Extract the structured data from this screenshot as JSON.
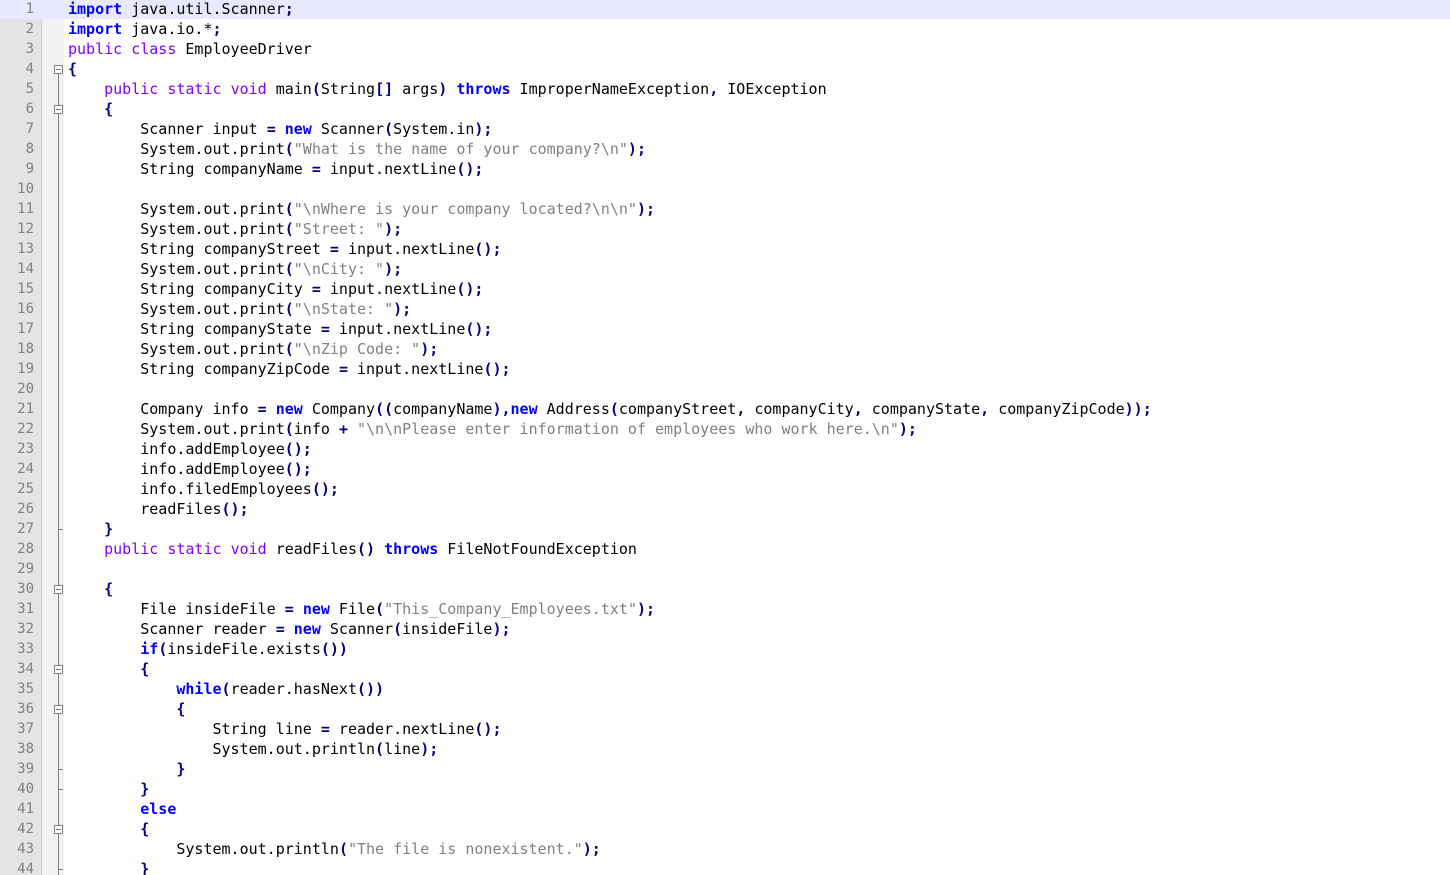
{
  "editor": {
    "current_line": 1,
    "lines": [
      {
        "n": "1",
        "code": "<span class='kw'>import</span> java.util.Scanner<span class='op'>;</span>"
      },
      {
        "n": "2",
        "code": "<span class='kw'>import</span> java.io.*<span class='op'>;</span>"
      },
      {
        "n": "3",
        "code": "<span class='kw2'>public</span> <span class='kw2'>class</span> EmployeeDriver"
      },
      {
        "n": "4",
        "code": "<span class='op'>{</span>"
      },
      {
        "n": "5",
        "code": "    <span class='kw2'>public</span> <span class='kw2'>static</span> <span class='kw2'>void</span> main<span class='op'>(</span>String<span class='op'>[]</span> args<span class='op'>)</span> <span class='kw'>throws</span> ImproperNameException<span class='op'>,</span> IOException"
      },
      {
        "n": "6",
        "code": "    <span class='op'>{</span>"
      },
      {
        "n": "7",
        "code": "        Scanner input <span class='op'>=</span> <span class='kw'>new</span> Scanner<span class='op'>(</span>System.in<span class='op'>);</span>"
      },
      {
        "n": "8",
        "code": "        System.out.print<span class='op'>(</span><span class='str'>\"What is the name of your company?\\n\"</span><span class='op'>);</span>"
      },
      {
        "n": "9",
        "code": "        String companyName <span class='op'>=</span> input.nextLine<span class='op'>();</span>"
      },
      {
        "n": "10",
        "code": ""
      },
      {
        "n": "11",
        "code": "        System.out.print<span class='op'>(</span><span class='str'>\"\\nWhere is your company located?\\n\\n\"</span><span class='op'>);</span>"
      },
      {
        "n": "12",
        "code": "        System.out.print<span class='op'>(</span><span class='str'>\"Street: \"</span><span class='op'>);</span>"
      },
      {
        "n": "13",
        "code": "        String companyStreet <span class='op'>=</span> input.nextLine<span class='op'>();</span>"
      },
      {
        "n": "14",
        "code": "        System.out.print<span class='op'>(</span><span class='str'>\"\\nCity: \"</span><span class='op'>);</span>"
      },
      {
        "n": "15",
        "code": "        String companyCity <span class='op'>=</span> input.nextLine<span class='op'>();</span>"
      },
      {
        "n": "16",
        "code": "        System.out.print<span class='op'>(</span><span class='str'>\"\\nState: \"</span><span class='op'>);</span>"
      },
      {
        "n": "17",
        "code": "        String companyState <span class='op'>=</span> input.nextLine<span class='op'>();</span>"
      },
      {
        "n": "18",
        "code": "        System.out.print<span class='op'>(</span><span class='str'>\"\\nZip Code: \"</span><span class='op'>);</span>"
      },
      {
        "n": "19",
        "code": "        String companyZipCode <span class='op'>=</span> input.nextLine<span class='op'>();</span>"
      },
      {
        "n": "20",
        "code": ""
      },
      {
        "n": "21",
        "code": "        Company info <span class='op'>=</span> <span class='kw'>new</span> Company<span class='op'>((</span>companyName<span class='op'>),</span><span class='kw'>new</span> Address<span class='op'>(</span>companyStreet<span class='op'>,</span> companyCity<span class='op'>,</span> companyState<span class='op'>,</span> companyZipCode<span class='op'>));</span>"
      },
      {
        "n": "22",
        "code": "        System.out.print<span class='op'>(</span>info <span class='op'>+</span> <span class='str'>\"\\n\\nPlease enter information of employees who work here.\\n\"</span><span class='op'>);</span>"
      },
      {
        "n": "23",
        "code": "        info.addEmployee<span class='op'>();</span>"
      },
      {
        "n": "24",
        "code": "        info.addEmployee<span class='op'>();</span>"
      },
      {
        "n": "25",
        "code": "        info.filedEmployees<span class='op'>();</span>"
      },
      {
        "n": "26",
        "code": "        readFiles<span class='op'>();</span>"
      },
      {
        "n": "27",
        "code": "    <span class='op'>}</span>"
      },
      {
        "n": "28",
        "code": "    <span class='kw2'>public</span> <span class='kw2'>static</span> <span class='kw2'>void</span> readFiles<span class='op'>()</span> <span class='kw'>throws</span> FileNotFoundException"
      },
      {
        "n": "29",
        "code": ""
      },
      {
        "n": "30",
        "code": "    <span class='op'>{</span>"
      },
      {
        "n": "31",
        "code": "        File insideFile <span class='op'>=</span> <span class='kw'>new</span> File<span class='op'>(</span><span class='str'>\"This_Company_Employees.txt\"</span><span class='op'>);</span>"
      },
      {
        "n": "32",
        "code": "        Scanner reader <span class='op'>=</span> <span class='kw'>new</span> Scanner<span class='op'>(</span>insideFile<span class='op'>);</span>"
      },
      {
        "n": "33",
        "code": "        <span class='kw'>if</span><span class='op'>(</span>insideFile.exists<span class='op'>())</span>"
      },
      {
        "n": "34",
        "code": "        <span class='op'>{</span>"
      },
      {
        "n": "35",
        "code": "            <span class='kw'>while</span><span class='op'>(</span>reader.hasNext<span class='op'>())</span>"
      },
      {
        "n": "36",
        "code": "            <span class='op'>{</span>"
      },
      {
        "n": "37",
        "code": "                String line <span class='op'>=</span> reader.nextLine<span class='op'>();</span>"
      },
      {
        "n": "38",
        "code": "                System.out.println<span class='op'>(</span>line<span class='op'>);</span>"
      },
      {
        "n": "39",
        "code": "            <span class='op'>}</span>"
      },
      {
        "n": "40",
        "code": "        <span class='op'>}</span>"
      },
      {
        "n": "41",
        "code": "        <span class='kw'>else</span>"
      },
      {
        "n": "42",
        "code": "        <span class='op'>{</span>"
      },
      {
        "n": "43",
        "code": "            System.out.println<span class='op'>(</span><span class='str'>\"The file is nonexistent.\"</span><span class='op'>);</span>"
      },
      {
        "n": "44",
        "code": "        <span class='op'>}</span>"
      }
    ],
    "fold_markers": [
      {
        "type": "box",
        "line": 4
      },
      {
        "type": "box",
        "line": 6
      },
      {
        "type": "end",
        "line": 27
      },
      {
        "type": "box",
        "line": 30
      },
      {
        "type": "box",
        "line": 34
      },
      {
        "type": "box",
        "line": 36
      },
      {
        "type": "end",
        "line": 39
      },
      {
        "type": "end",
        "line": 40
      },
      {
        "type": "box",
        "line": 42
      },
      {
        "type": "end",
        "line": 44
      }
    ]
  }
}
